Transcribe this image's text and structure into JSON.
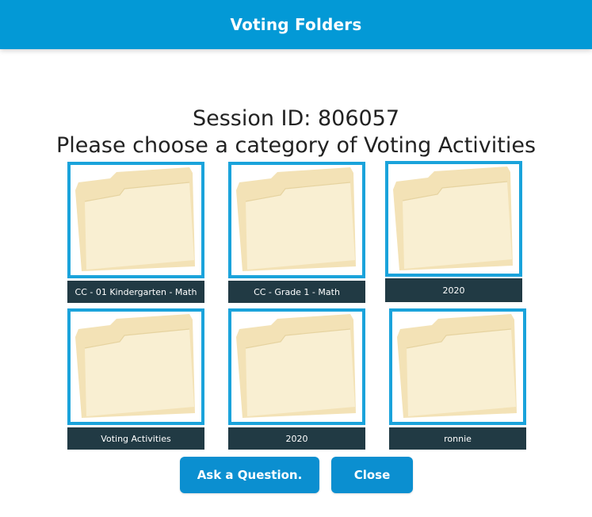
{
  "header": {
    "title": "Voting Folders"
  },
  "session": {
    "text": "Session ID: 806057"
  },
  "prompt": {
    "text": "Please choose a category of Voting Activities"
  },
  "folders": [
    {
      "label": "CC - 01 Kindergarten - Math",
      "icon": "folder-icon"
    },
    {
      "label": "CC - Grade 1 - Math",
      "icon": "folder-icon"
    },
    {
      "label": "2020",
      "icon": "folder-icon"
    },
    {
      "label": "Voting Activities",
      "icon": "folder-icon"
    },
    {
      "label": "2020",
      "icon": "folder-icon"
    },
    {
      "label": "ronnie",
      "icon": "folder-icon"
    }
  ],
  "buttons": {
    "ask": "Ask a Question.",
    "close": "Close"
  },
  "colors": {
    "header": "#0399d6",
    "thumb_border": "#1aa3db",
    "label_bg": "#213a44",
    "button": "#0b8fd0",
    "folder_fill": "#f8ecc9"
  }
}
